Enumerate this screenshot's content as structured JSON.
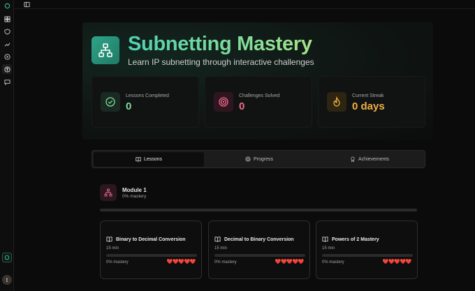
{
  "rail": {
    "icons": [
      "logo-icon",
      "dashboard-icon",
      "shield-icon",
      "trending-icon",
      "play-icon",
      "subnet-icon",
      "chat-icon"
    ],
    "avatar_initial": "t"
  },
  "hero": {
    "title": "Subnetting Mastery",
    "subtitle": "Learn IP subnetting through interactive challenges",
    "stats": [
      {
        "label": "Lessons Completed",
        "value": "0",
        "color": "#7fdc9a"
      },
      {
        "label": "Challenges Solved",
        "value": "0",
        "color": "#f06a8a"
      },
      {
        "label": "Current Streak",
        "value": "0 days",
        "color": "#f0b040"
      }
    ]
  },
  "tabs": [
    {
      "label": "Lessons",
      "icon": "book-icon",
      "active": true
    },
    {
      "label": "Progress",
      "icon": "target-icon",
      "active": false
    },
    {
      "label": "Achievements",
      "icon": "award-icon",
      "active": false
    }
  ],
  "module": {
    "title": "Module 1",
    "mastery": "0% mastery",
    "progress": 0
  },
  "lessons": [
    {
      "title": "Binary to Decimal Conversion",
      "duration": "15 min",
      "mastery": "0% mastery",
      "hearts": "❤️❤️❤️❤️❤️"
    },
    {
      "title": "Decimal to Binary Conversion",
      "duration": "15 min",
      "mastery": "0% mastery",
      "hearts": "❤️❤️❤️❤️❤️"
    },
    {
      "title": "Powers of 2 Mastery",
      "duration": "15 min",
      "mastery": "0% mastery",
      "hearts": "❤️❤️❤️❤️❤️"
    }
  ]
}
